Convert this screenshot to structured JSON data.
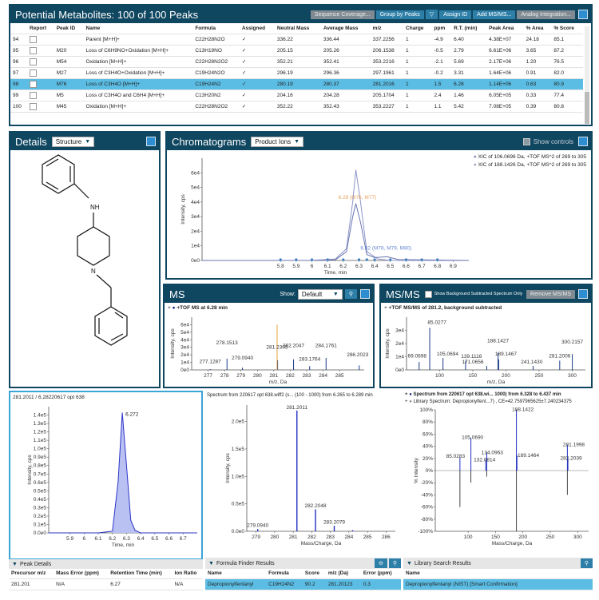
{
  "metabolites": {
    "title": "Potential Metabolites: 100 of 100 Peaks",
    "buttons": [
      "Sequence Coverage...",
      "Group by Peaks",
      "Assign ID",
      "Add MS/MS...",
      "Analog Integration..."
    ],
    "columns": [
      "Report",
      "Peak ID",
      "Name",
      "Formula",
      "Assigned",
      "Neutral Mass",
      "Average Mass",
      "m/z",
      "Charge",
      "ppm",
      "R.T. (min)",
      "Peak Area",
      "% Area",
      "% Score"
    ],
    "rows": [
      [
        "94",
        "",
        "Parent [M+H]+",
        "C22H28N2O",
        "✓",
        "336.22",
        "336.44",
        "337.2256",
        "1",
        "-4.9",
        "6.40",
        "4.38E+07",
        "24.18",
        "85.1"
      ],
      [
        "95",
        "M20",
        "Loss of C6H9NO+Oxidation [M+H]+",
        "C13H19NO",
        "✓",
        "205.15",
        "205.26",
        "206.1538",
        "1",
        "-0.5",
        "2.79",
        "6.61E+06",
        "3.65",
        "87.2"
      ],
      [
        "96",
        "M54",
        "Oxidation [M+H]+",
        "C22H28N2O2",
        "✓",
        "352.21",
        "352.41",
        "353.2216",
        "1",
        "-2.1",
        "5.69",
        "2.17E+06",
        "1.20",
        "76.5"
      ],
      [
        "97",
        "M27",
        "Loss of C3H4O+Oxidation [M+H]+",
        "C19H24N2O",
        "✓",
        "296.19",
        "296.36",
        "297.1961",
        "1",
        "-0.2",
        "3.31",
        "1.64E+06",
        "0.91",
        "82.0"
      ],
      [
        "98",
        "M76",
        "Loss of C3H4O [M+H]+",
        "C19H24N2",
        "✓",
        "280.19",
        "280.37",
        "281.2016",
        "1",
        "1.5",
        "6.28",
        "1.14E+06",
        "0.63",
        "80.9"
      ],
      [
        "99",
        "M5",
        "Loss of C3H4O and C6H4 [M+H]+",
        "C13H20N2",
        "✓",
        "204.16",
        "204.28",
        "205.1704",
        "1",
        "2.4",
        "1.46",
        "6.05E+05",
        "0.33",
        "77.4"
      ],
      [
        "100",
        "M45",
        "Oxidation [M+H]+",
        "C22H28N2O2",
        "✓",
        "352.22",
        "352.43",
        "353.2227",
        "1",
        "1.1",
        "5.42",
        "7.08E+05",
        "0.39",
        "80.8"
      ]
    ],
    "selected_row": 4
  },
  "details": {
    "title": "Details",
    "dropdown": "Structure",
    "atom_label": "NH",
    "atom_label2": "N"
  },
  "chromatograms": {
    "title": "Chromatograms",
    "dropdown": "Product Ions",
    "show_controls": "Show controls",
    "legend": [
      "XIC of 106.0696 Da, +TOF MS^2 of 269 to 305",
      "XIC of 188.1426 Da, +TOF MS^2 of 269 to 305"
    ],
    "ylabel": "Intensity, cps",
    "xlabel": "Time, min",
    "annotation1": "6.28 (M76, M77)",
    "annotation2": "6.32 (M78, M79, M80)"
  },
  "ms": {
    "title": "MS",
    "show_label": "Show:",
    "dropdown": "Default",
    "trace_label": "+TOF MS at 6.28 min",
    "ylabel": "Intensity, cps",
    "xlabel": "m/z, Da",
    "peak_labels": [
      "278.1513",
      "281.2305",
      "277.1287",
      "279.0940",
      "282.2047",
      "283.1764",
      "284.1761",
      "286.2023"
    ]
  },
  "msms": {
    "title": "MS/MS",
    "checkbox_label": "Show Background Subtracted Spectrum Only",
    "remove_button": "Remove MS/MS",
    "trace_label": "+TOF MS/MS of 281.2, background subtracted",
    "ylabel": "Intensity, cps",
    "xlabel": "m/z, Da",
    "peak_labels": [
      "85.0277",
      "188.1427",
      "300.2157",
      "69.0698",
      "105.0694",
      "139.1116",
      "189.1467",
      "281.2006",
      "171.0656",
      "241.1430"
    ]
  },
  "xic": {
    "title": "281.2011 / 6.28220617 opt 638",
    "ylabel": "Intensity, cps",
    "xlabel": "Time, min",
    "peak_label": "6.272"
  },
  "spectrum": {
    "title": "Spectrum from 220617 opt 638.wiff2 (s... (100 - 1000) from 6.265 to 6.289 min",
    "ylabel": "Intensity, cps",
    "xlabel": "Mass/Charge, Da",
    "peak_labels": [
      "281.2011",
      "282.2048",
      "279.0940",
      "283.2079"
    ]
  },
  "library": {
    "title": "Spectrum from 220617 opt 638.wi... 1000) from 6.328 to 6.437 min",
    "subtitle": "Library Spectrum: Depropionylfent...7) , CE=42.7597965625±7.240234375",
    "ylabel": "% Intensity",
    "xlabel": "Mass/Charge, Da",
    "peak_labels": [
      "188.1422",
      "105.0690",
      "134.0963",
      "85.0283",
      "132.0814",
      "189.1464",
      "281.1998",
      "282.2039"
    ]
  },
  "peak_details": {
    "title": "Peak Details",
    "columns": [
      "Precursor m/z",
      "Mass Error (ppm)",
      "Retention Time (min)",
      "Ion Ratio"
    ],
    "row": [
      "281.201",
      "N/A",
      "6.27",
      "N/A"
    ]
  },
  "formula_finder": {
    "title": "Formula Finder Results",
    "columns": [
      "Name",
      "Formula",
      "Score",
      "m/z (Da)",
      "Error (ppm)"
    ],
    "row": [
      "Depropionylfentanyl",
      "C19H24N2",
      "90.2",
      "281.20123",
      "0.3"
    ]
  },
  "library_results": {
    "title": "Library Search Results",
    "columns": [
      "Name"
    ],
    "row": [
      "Depropionylfentanyl (NIST) [Smart Confirmation]"
    ]
  },
  "chart_data": [
    {
      "type": "line",
      "title": "Chromatograms",
      "ylabel": "Intensity, cps",
      "xlabel": "Time, min",
      "xlim": [
        5.3,
        7.0
      ],
      "ylim": [
        0,
        70000
      ],
      "series": [
        {
          "name": "XIC of 106.0696 Da, +TOF MS^2 of 269 to 305",
          "x": [
            5.3,
            6.0,
            6.15,
            6.22,
            6.26,
            6.28,
            6.31,
            6.35,
            6.42,
            6.5,
            7.0
          ],
          "y": [
            0,
            0,
            1000,
            8000,
            40000,
            62000,
            40000,
            6000,
            1000,
            0,
            0
          ]
        },
        {
          "name": "XIC of 188.1426 Da, +TOF MS^2 of 269 to 305",
          "x": [
            5.3,
            6.0,
            6.15,
            6.22,
            6.26,
            6.28,
            6.31,
            6.35,
            6.4,
            6.48,
            6.55,
            7.0
          ],
          "y": [
            0,
            0,
            500,
            6000,
            30000,
            39000,
            26000,
            4000,
            2000,
            2500,
            600,
            0
          ]
        }
      ]
    },
    {
      "type": "bar",
      "title": "MS",
      "xlim": [
        276,
        286.5
      ],
      "ylim": [
        0,
        70000
      ],
      "x": [
        277.13,
        278.15,
        279.09,
        281.23,
        281.2,
        282.2,
        283.18,
        284.18,
        286.2
      ],
      "y": [
        1000,
        15000,
        3000,
        13000,
        60000,
        14000,
        5000,
        16000,
        6000
      ]
    },
    {
      "type": "bar",
      "title": "MS/MS",
      "xlim": [
        50,
        320
      ],
      "ylim": [
        0,
        40000
      ],
      "x": [
        69.07,
        85.03,
        105.07,
        139.11,
        171.07,
        188.14,
        189.15,
        241.14,
        281.2,
        300.22
      ],
      "y": [
        6000,
        32000,
        9000,
        7000,
        3000,
        13000,
        8000,
        3000,
        7000,
        12000
      ]
    },
    {
      "type": "line",
      "title": "281.2011 / 6.28220617 opt 638",
      "ylabel": "Intensity, cps",
      "xlabel": "Time, min",
      "xlim": [
        5.75,
        6.8
      ],
      "ylim": [
        0,
        150000
      ],
      "x": [
        5.75,
        6.1,
        6.2,
        6.24,
        6.27,
        6.3,
        6.33,
        6.36,
        6.4,
        6.8
      ],
      "y": [
        0,
        0,
        2000,
        60000,
        143000,
        80000,
        15000,
        3000,
        0,
        0
      ]
    },
    {
      "type": "bar",
      "title": "Spectrum from 220617 opt 638.wiff2",
      "ylabel": "Intensity, cps",
      "xlabel": "Mass/Charge, Da",
      "xlim": [
        278.5,
        286.5
      ],
      "ylim": [
        0,
        230000
      ],
      "x": [
        279.09,
        281.2,
        282.2,
        283.21,
        284.2
      ],
      "y": [
        4000,
        220000,
        40000,
        10000,
        2000
      ]
    },
    {
      "type": "bar",
      "title": "Library comparison",
      "ylabel": "% Intensity",
      "xlabel": "Mass/Charge, Da",
      "xlim": [
        40,
        320
      ],
      "ylim": [
        -100,
        100
      ],
      "series": [
        {
          "name": "Spectrum from 220617 opt 638",
          "x": [
            85.03,
            105.07,
            132.08,
            134.1,
            188.14,
            189.15,
            281.2,
            282.2
          ],
          "y": [
            22,
            54,
            18,
            30,
            100,
            25,
            42,
            20
          ]
        },
        {
          "name": "Library Spectrum",
          "x": [
            85.0,
            105.0,
            134.0,
            188.1,
            281.2
          ],
          "y": [
            -60,
            -20,
            -10,
            -100,
            -40
          ]
        }
      ]
    }
  ]
}
